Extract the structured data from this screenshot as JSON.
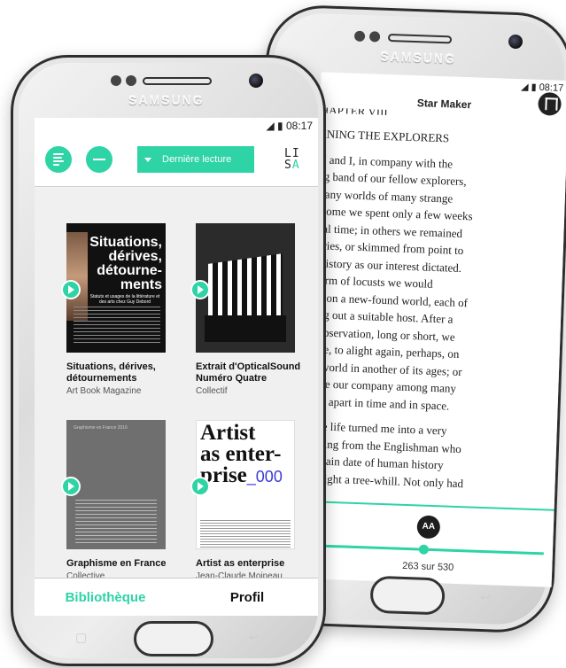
{
  "reader": {
    "status_time": "08:17",
    "title": "Star Maker",
    "chapter_heading": "CHAPTER VIII",
    "paragraphs": [
      "ERNING THE EXPLORERS",
      "TU and I, in company with the\nsing band of our fellow explorers,\nl many worlds of many strange\n In some we spent only a few weeks\nlocal time; in others we remained\nnturies, or skimmed from point to\nof history as our interest dictated.\n swarm of locusts we would\nd upon a new-found world, each of\ngling out a suitable host. After a\n of observation, long or short, we\n leave, to alight again, perhaps, on\nme world in another of its ages; or\nribute our company among many\ns, far apart in time and in space.",
      "range life turned me into a very\nnt being from the Englishman who\n a certain date of human history\nhat tright a tree-whill. Not only had"
    ],
    "font_button": "AA",
    "page_indicator": "263 sur 530",
    "progress_fraction": 0.496
  },
  "library": {
    "status_time": "08:17",
    "dropdown_label": "Dernière lecture",
    "logo_top": "LI",
    "logo_bottom_left": "S",
    "logo_bottom_right": "A",
    "books": [
      {
        "title": "Situations, dérives, détournements",
        "author": "Art Book Magazine",
        "cover_text": "Situations,\ndérives,\ndétourne-\nments",
        "cover_sub": "Statuts et usages de la littérature et des arts chez Guy Debord"
      },
      {
        "title": "Extrait d'OpticalSound Numéro Quatre",
        "author": "Collectif"
      },
      {
        "title": "Graphisme en France",
        "author": "Collective",
        "cover_text": "Graphisme en France 2016"
      },
      {
        "title": "Artist as enterprise",
        "author": "Jean-Claude Moineau",
        "cover_text": "Artist\nas    enter-\nprise",
        "cover_number": "_000"
      }
    ],
    "tabs": [
      "Bibliothèque",
      "Profil"
    ]
  },
  "device": {
    "brand": "SAMSUNG"
  },
  "colors": {
    "accent": "#2ed3a6",
    "text": "#111111"
  }
}
